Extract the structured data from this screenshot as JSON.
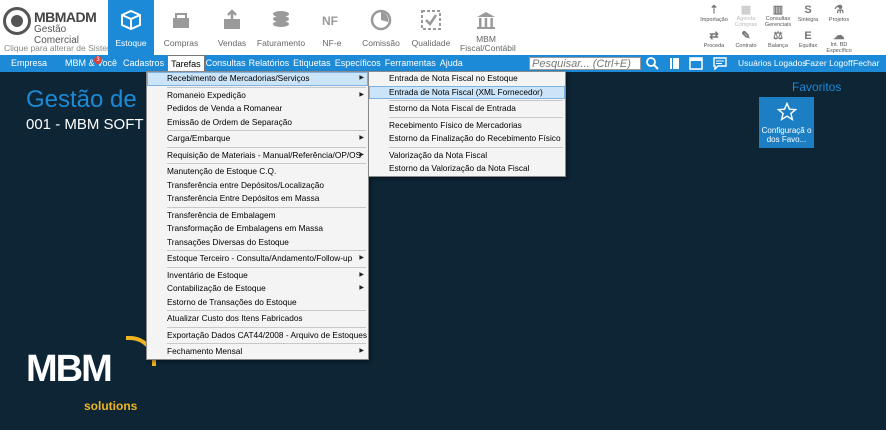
{
  "app": {
    "logo_title": "MBMADM",
    "logo_subtitle": "Gestão Comercial",
    "logo_hint": "Clique para alterar de Sistema"
  },
  "ribbon": {
    "main": [
      {
        "label": "Estoque",
        "icon": "box-icon",
        "active": true
      },
      {
        "label": "Compras",
        "icon": "purchase-icon",
        "active": false
      },
      {
        "label": "Vendas",
        "icon": "sales-icon",
        "active": false
      },
      {
        "label": "Faturamento",
        "icon": "coins-icon",
        "active": false
      },
      {
        "label": "NF-e",
        "icon": "nfe-icon",
        "active": false
      },
      {
        "label": "Comissão",
        "icon": "pie-icon",
        "active": false
      },
      {
        "label": "Qualidade",
        "icon": "check-icon",
        "active": false
      },
      {
        "label": "MBM Fiscal/Contábil",
        "icon": "building-icon",
        "active": false
      }
    ],
    "small": [
      {
        "label": "Importação",
        "glyph": "⇡",
        "dim": false
      },
      {
        "label": "Agenda Compras",
        "glyph": "▦",
        "dim": true
      },
      {
        "label": "Consultas Gerenciais",
        "glyph": "▥",
        "dim": false
      },
      {
        "label": "Sintegra",
        "glyph": "S",
        "dim": false
      },
      {
        "label": "Projetos",
        "glyph": "⚗",
        "dim": false
      },
      {
        "label": "Proceda",
        "glyph": "⇄",
        "dim": false
      },
      {
        "label": "Contrato",
        "glyph": "✎",
        "dim": false
      },
      {
        "label": "Balança",
        "glyph": "⚖",
        "dim": false
      },
      {
        "label": "Equifax",
        "glyph": "E",
        "dim": false
      },
      {
        "label": "Int. BD Específico",
        "glyph": "☁",
        "dim": false
      }
    ]
  },
  "menubar": {
    "items": [
      "Empresa",
      "MBM & Você",
      "Cadastros",
      "Tarefas",
      "Consultas",
      "Relatórios",
      "Etiquetas",
      "Específicos",
      "Ferramentas",
      "Ajuda"
    ],
    "badge": "3",
    "search_placeholder": "Pesquisar... (Ctrl+E)",
    "right": [
      "Usuários Logados",
      "Fazer Logoff",
      "Fechar"
    ]
  },
  "main": {
    "title": "Gestão de",
    "subtitle": "001 - MBM SOFT"
  },
  "favorites": {
    "title": "Favoritos",
    "tile_label": "Configuraçã o dos Favo..."
  },
  "brand": {
    "name": "MBM",
    "sub": "solutions"
  },
  "tarefas_menu": [
    {
      "label": "Recebimento de Mercadorias/Serviços",
      "submenu": true,
      "highlighted": true
    },
    {
      "sep": true
    },
    {
      "label": "Romaneio Expedição",
      "submenu": true
    },
    {
      "label": "Pedidos de Venda a Romanear"
    },
    {
      "label": "Emissão de Ordem de Separação"
    },
    {
      "sep": true
    },
    {
      "label": "Carga/Embarque",
      "submenu": true
    },
    {
      "sep": true
    },
    {
      "label": "Requisição de Materiais - Manual/Referência/OP/OS",
      "submenu": true
    },
    {
      "sep": true
    },
    {
      "label": "Manutenção de Estoque C.Q."
    },
    {
      "label": "Transferência entre Depósitos/Localização"
    },
    {
      "label": "Transferência Entre Depósitos em Massa"
    },
    {
      "sep": true
    },
    {
      "label": "Transferência de Embalagem"
    },
    {
      "label": "Transformação de Embalagens em Massa"
    },
    {
      "label": "Transações Diversas do Estoque"
    },
    {
      "sep": true
    },
    {
      "label": "Estoque Terceiro - Consulta/Andamento/Follow-up",
      "submenu": true
    },
    {
      "sep": true
    },
    {
      "label": "Inventário de Estoque",
      "submenu": true
    },
    {
      "label": "Contabilização de Estoque",
      "submenu": true
    },
    {
      "label": "Estorno de Transações do Estoque"
    },
    {
      "sep": true
    },
    {
      "label": "Atualizar Custo dos Itens Fabricados"
    },
    {
      "sep": true
    },
    {
      "label": "Exportação Dados CAT44/2008 - Arquivo de Estoques"
    },
    {
      "sep": true
    },
    {
      "label": "Fechamento Mensal",
      "submenu": true
    }
  ],
  "recebimento_submenu": [
    {
      "label": "Entrada de Nota Fiscal no Estoque"
    },
    {
      "label": "Entrada de Nota Fiscal (XML Fornecedor)",
      "highlighted": true
    },
    {
      "sep": true
    },
    {
      "label": "Estorno da Nota Fiscal de Entrada"
    },
    {
      "sep": true
    },
    {
      "label": "Recebimento Físico de Mercadorias"
    },
    {
      "label": "Estorno da Finalização do Recebimento Físico"
    },
    {
      "sep": true
    },
    {
      "label": "Valorização da Nota Fiscal"
    },
    {
      "label": "Estorno da Valorização da Nota Fiscal"
    }
  ]
}
